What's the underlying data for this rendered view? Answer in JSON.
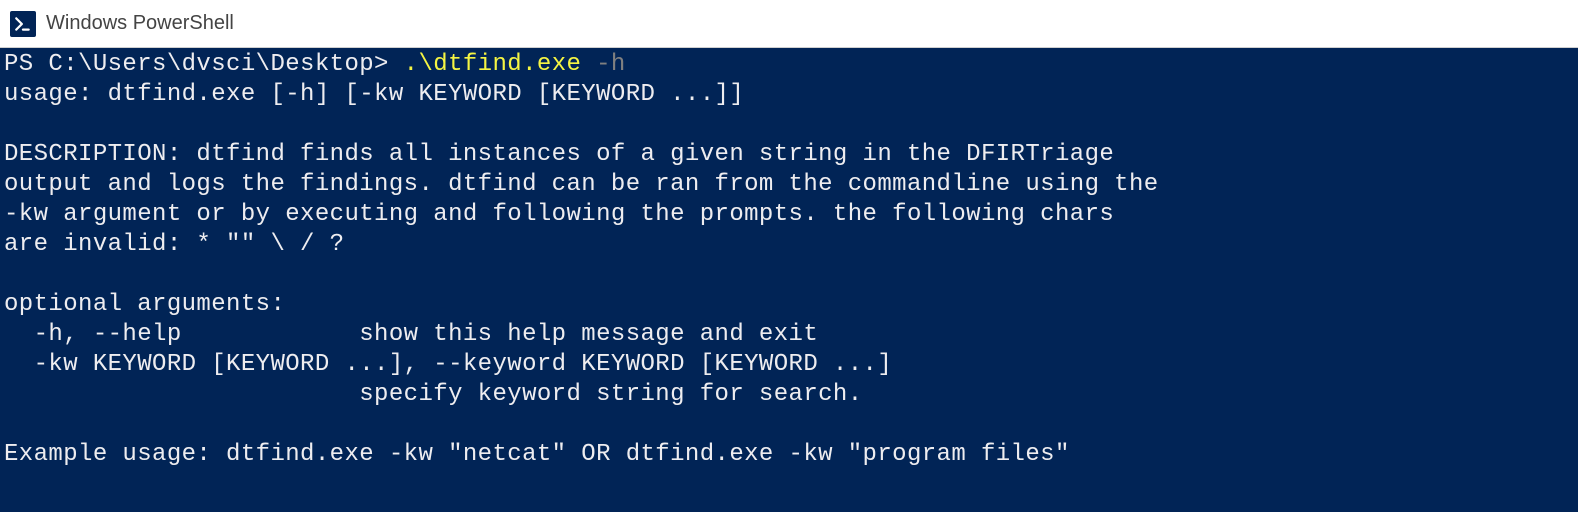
{
  "window": {
    "title": "Windows PowerShell"
  },
  "terminal": {
    "prompt": "PS C:\\Users\\dvsci\\Desktop> ",
    "command": ".\\dtfind.exe",
    "flag": " -h",
    "usage": "usage: dtfind.exe [-h] [-kw KEYWORD [KEYWORD ...]]",
    "blank1": "",
    "desc1": "DESCRIPTION: dtfind finds all instances of a given string in the DFIRTriage",
    "desc2": "output and logs the findings. dtfind can be ran from the commandline using the",
    "desc3": "-kw argument or by executing and following the prompts. the following chars",
    "desc4": "are invalid: * \"\" \\ / ?",
    "blank2": "",
    "optargs_header": "optional arguments:",
    "opt_h": "  -h, --help            show this help message and exit",
    "opt_kw1": "  -kw KEYWORD [KEYWORD ...], --keyword KEYWORD [KEYWORD ...]",
    "opt_kw2": "                        specify keyword string for search.",
    "blank3": "",
    "example": "Example usage: dtfind.exe -kw \"netcat\" OR dtfind.exe -kw \"program files\""
  }
}
